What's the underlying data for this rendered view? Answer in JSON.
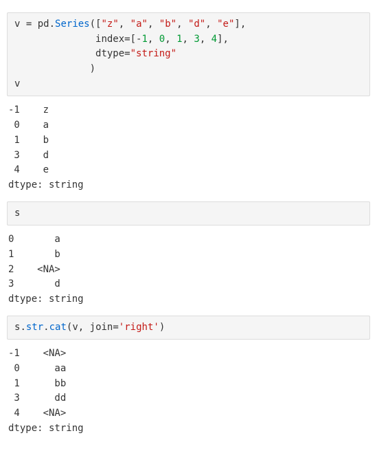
{
  "cells": {
    "c1": {
      "t": {
        "v": "v",
        "eq": " = ",
        "pd": "pd",
        "dot1": ".",
        "series": "Series",
        "op": "(",
        "ob": "[",
        "s1": "\"z\"",
        "com": ", ",
        "s2": "\"a\"",
        "s3": "\"b\"",
        "s4": "\"d\"",
        "s5": "\"e\"",
        "cb": "]",
        "com2": ",",
        "pad2": "              ",
        "index": "index",
        "eq2": "=",
        "ob2": "[",
        "n_m1": "-",
        "n1": "1",
        "n0": "0",
        "n1b": "1",
        "n3": "3",
        "n4": "4",
        "cb2": "]",
        "com3": ",",
        "pad3": "              ",
        "dtype": "dtype",
        "eq3": "=",
        "dtype_s": "\"string\"",
        "pad4": "             ",
        "cp": ")",
        "v_echo": "v"
      }
    },
    "c2": {
      "code": "s"
    },
    "c3": {
      "t": {
        "s": "s",
        "dot": ".",
        "str": "str",
        "dot2": ".",
        "cat": "cat",
        "op": "(",
        "v": "v",
        "com": ", ",
        "join": "join",
        "eq": "=",
        "right": "'right'",
        "cp": ")"
      }
    }
  },
  "outputs": {
    "o1": "-1    z\n 0    a\n 1    b\n 3    d\n 4    e\ndtype: string",
    "o2": "0       a\n1       b\n2    <NA>\n3       d\ndtype: string",
    "o3": "-1    <NA>\n 0      aa\n 1      bb\n 3      dd\n 4    <NA>\ndtype: string"
  }
}
